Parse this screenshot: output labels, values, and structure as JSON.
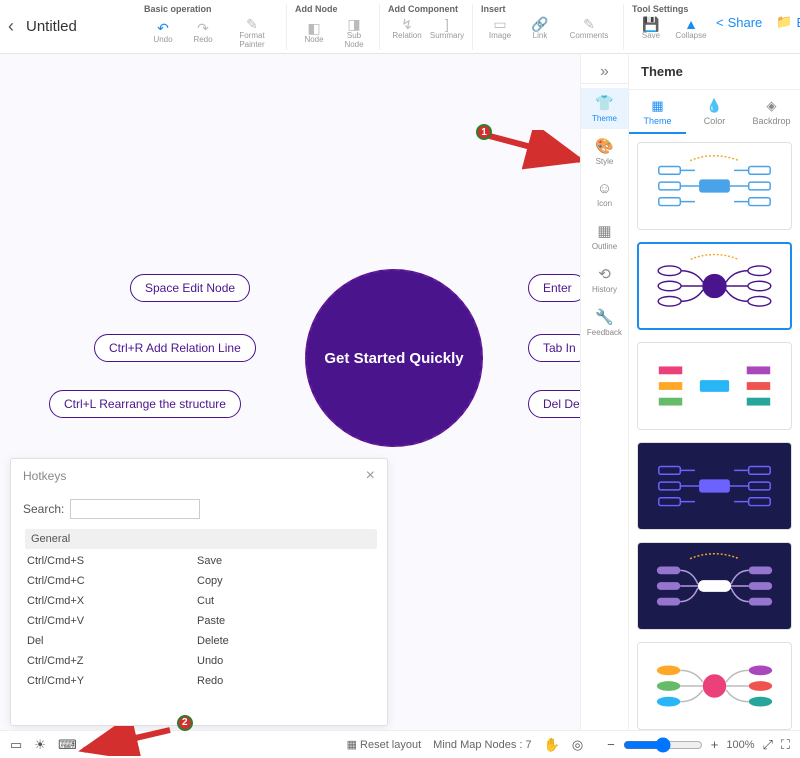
{
  "doc": {
    "title": "Untitled"
  },
  "toolbar": {
    "groups": {
      "basic": {
        "label": "Basic operation",
        "undo": "Undo",
        "redo": "Redo",
        "format_painter": "Format Painter"
      },
      "add_node": {
        "label": "Add Node",
        "node": "Node",
        "sub_node": "Sub Node"
      },
      "add_component": {
        "label": "Add Component",
        "relation": "Relation",
        "summary": "Summary"
      },
      "insert": {
        "label": "Insert",
        "image": "Image",
        "link": "Link",
        "comments": "Comments"
      },
      "tool_settings": {
        "label": "Tool Settings",
        "save": "Save",
        "collapse": "Collapse"
      }
    },
    "share": "Share",
    "export": "Export"
  },
  "mindmap": {
    "center": "Get Started Quickly",
    "left": [
      "Space Edit Node",
      "Ctrl+R Add Relation Line",
      "Ctrl+L Rearrange the structure"
    ],
    "right": [
      "Enter",
      "Tab In",
      "Del De"
    ]
  },
  "callouts": {
    "one": "1",
    "two": "2"
  },
  "hotkeys": {
    "title": "Hotkeys",
    "search_label": "Search:",
    "section": "General",
    "rows": [
      {
        "k": "Ctrl/Cmd+S",
        "v": "Save"
      },
      {
        "k": "Ctrl/Cmd+C",
        "v": "Copy"
      },
      {
        "k": "Ctrl/Cmd+X",
        "v": "Cut"
      },
      {
        "k": "Ctrl/Cmd+V",
        "v": "Paste"
      },
      {
        "k": "Del",
        "v": "Delete"
      },
      {
        "k": "Ctrl/Cmd+Z",
        "v": "Undo"
      },
      {
        "k": "Ctrl/Cmd+Y",
        "v": "Redo"
      }
    ]
  },
  "side_tabs": {
    "theme": "Theme",
    "style": "Style",
    "icon": "Icon",
    "outline": "Outline",
    "history": "History",
    "feedback": "Feedback"
  },
  "theme_panel": {
    "title": "Theme",
    "tabs": {
      "theme": "Theme",
      "color": "Color",
      "backdrop": "Backdrop"
    }
  },
  "statusbar": {
    "reset_layout": "Reset layout",
    "node_count_label": "Mind Map Nodes :",
    "node_count": "7",
    "zoom": "100%"
  }
}
